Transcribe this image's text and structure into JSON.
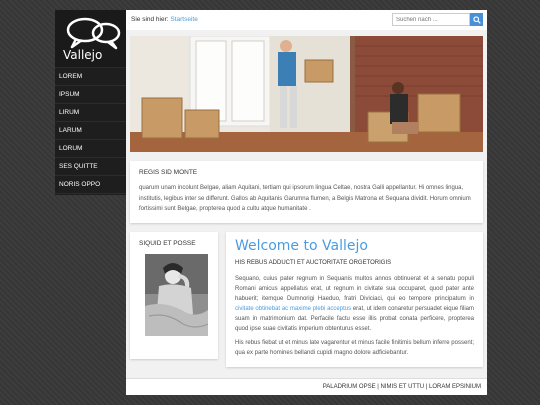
{
  "brand": {
    "name": "Vallejo"
  },
  "nav": {
    "items": [
      "LOREM",
      "IPSUM",
      "LIRUM",
      "LARUM",
      "LORUM",
      "SES QUITTE",
      "NORIS OPPO"
    ]
  },
  "header": {
    "crumb_label": "Sie sind hier:",
    "crumb_link": "Startseite",
    "search_placeholder": "Suchen nach ..."
  },
  "intro": {
    "title": "REGIS SID MONTE",
    "body": "quarum unam incolunt Belgae, aliam Aquitani, tertiam qui ipsorum lingua Celtae, nostra Galli appellantur. Hi omnes lingua, institutis, legibus inter se differunt. Gallos ab Aquitanis Garumna flumen, a Belgis Matrona et Sequana dividit. Horum omnium fortissimi sunt Belgae, propterea quod a cultu atque humanitate ."
  },
  "side_box": {
    "title": "SIQUID ET POSSE"
  },
  "welcome": {
    "title": "Welcome to Vallejo",
    "subtitle": "HIS REBUS ADDUCTI ET AUCTORITATE ORGETORIGIS",
    "para1_a": "Sequano, cuius pater regnum in Sequanis multos annos obtinuerat et a senatu populi Romani amicus appellatus erat, ut regnum in civitate sua occuparet, quod pater ante habuerit; itemque Dumnorigi Haeduo, fratri Diviciaci, qui eo tempore principatum in ",
    "para1_link": "civitate obtinebat ac maxime plebi acceptus",
    "para1_b": " erat, ut idem conaretur persuadet eique filiam suam in matrimonium dat. Perfacile factu esse illis probat conata perficere, propterea quod ipse suae civitatis imperium obtenturus esset.",
    "para2": "His rebus fiebat ut et minus late vagarentur et minus facile finitimis bellum inferre possent; qua ex parte homines bellandi cupidi magno dolore adficiebantur."
  },
  "footer": {
    "links": [
      "PALADRIUM OPSE",
      "NIMIS ET UTTU",
      "LORAM EPSINIUM"
    ],
    "separator": " | "
  },
  "colors": {
    "accent": "#4a9be0",
    "sidebar": "#1e1e1e"
  },
  "icons": {
    "search": "magnifier-icon",
    "logo": "speech-bubbles-icon"
  }
}
